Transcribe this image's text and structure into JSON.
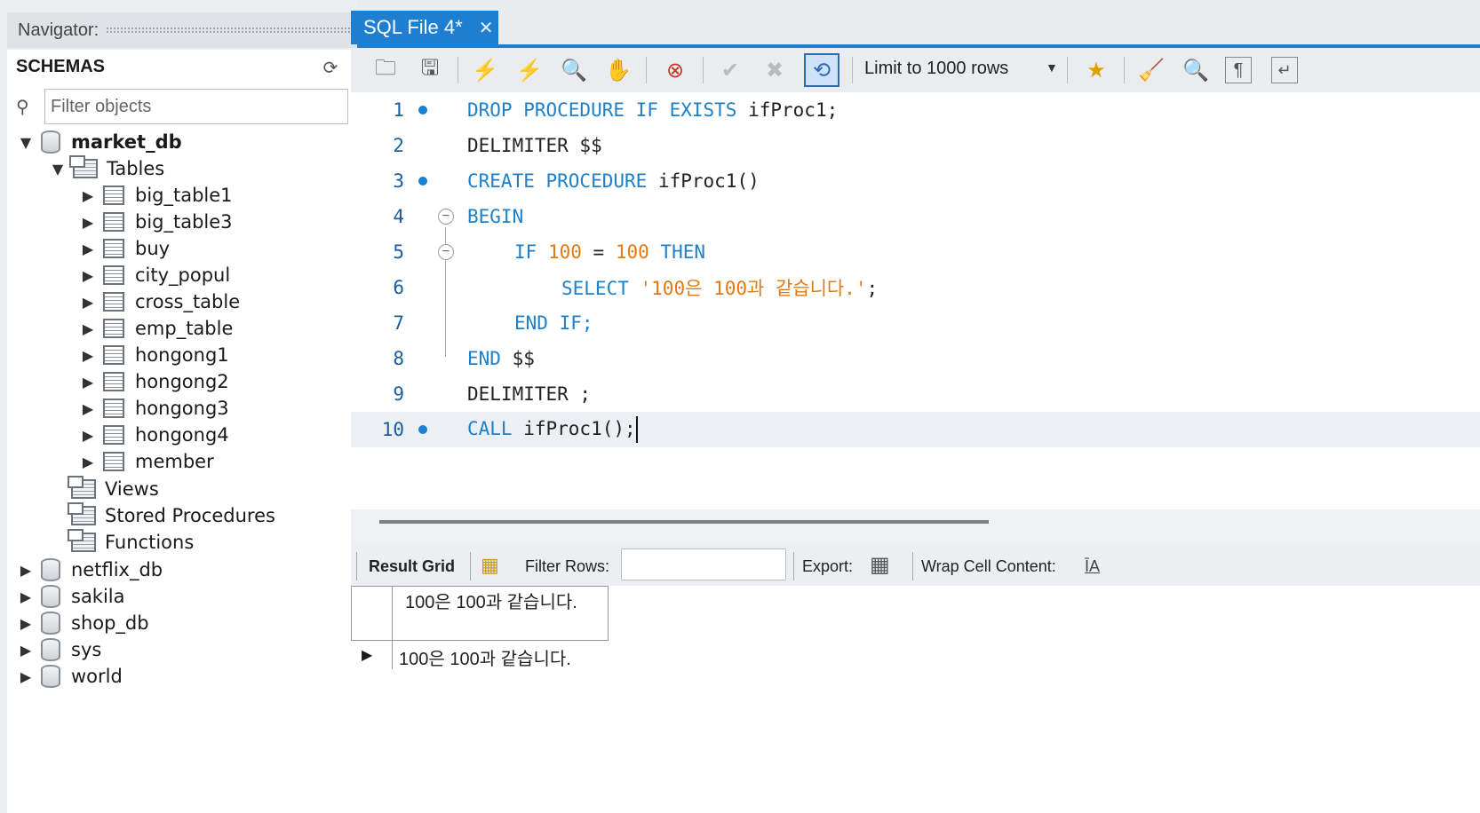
{
  "navigator": {
    "title": "Navigator:",
    "schemas_label": "SCHEMAS",
    "filter_placeholder": "Filter objects",
    "databases": [
      {
        "name": "market_db",
        "expanded": true
      },
      {
        "name": "netflix_db"
      },
      {
        "name": "sakila"
      },
      {
        "name": "shop_db"
      },
      {
        "name": "sys"
      },
      {
        "name": "world"
      }
    ],
    "folders": {
      "tables": "Tables",
      "views": "Views",
      "procedures": "Stored Procedures",
      "functions": "Functions"
    },
    "tables": [
      "big_table1",
      "big_table3",
      "buy",
      "city_popul",
      "cross_table",
      "emp_table",
      "hongong1",
      "hongong2",
      "hongong3",
      "hongong4",
      "member"
    ]
  },
  "tab": {
    "label": "SQL File 4*",
    "close": "✕"
  },
  "toolbar": {
    "limit_label": "Limit to 1000 rows",
    "icons": [
      "open-file-icon",
      "save-icon",
      "execute-icon",
      "execute-current-icon",
      "explain-icon",
      "stop-icon",
      "toggle-errors-icon",
      "commit-icon",
      "rollback-icon",
      "autocommit-icon",
      "bookmark-icon",
      "beautify-icon",
      "find-icon",
      "invisible-chars-icon",
      "wrap-icon"
    ]
  },
  "editor": {
    "lines": [
      {
        "n": "1",
        "dot": true
      },
      {
        "n": "2"
      },
      {
        "n": "3",
        "dot": true
      },
      {
        "n": "4",
        "fold": true
      },
      {
        "n": "5",
        "fold": true
      },
      {
        "n": "6"
      },
      {
        "n": "7"
      },
      {
        "n": "8"
      },
      {
        "n": "9"
      },
      {
        "n": "10",
        "dot": true
      }
    ],
    "tokens": {
      "l1a": "DROP PROCEDURE IF EXISTS",
      "l1b": " ifProc1;",
      "l2": "DELIMITER $$",
      "l3a": "CREATE PROCEDURE",
      "l3b": " ifProc1()",
      "l4": "BEGIN",
      "l5a": "IF",
      "l5b": "100",
      "l5c": " = ",
      "l5d": "100",
      "l5e": "THEN",
      "l6a": "SELECT",
      "l6b": "'100은 100과 같습니다.'",
      "l6c": ";",
      "l7": "END IF;",
      "l8a": "END",
      "l8b": " $$",
      "l9": "DELIMITER ;",
      "l10a": "CALL",
      "l10b": " ifProc1();"
    }
  },
  "results": {
    "result_grid_label": "Result Grid",
    "filter_rows_label": "Filter Rows:",
    "export_label": "Export:",
    "wrap_label": "Wrap Cell Content:",
    "column_header": "100은 100과 같습니다.",
    "row_value": "100은 100과 같습니다."
  },
  "colors": {
    "accent": "#1e7fd0",
    "keyword": "#1e80c8",
    "literal": "#e07a12"
  }
}
